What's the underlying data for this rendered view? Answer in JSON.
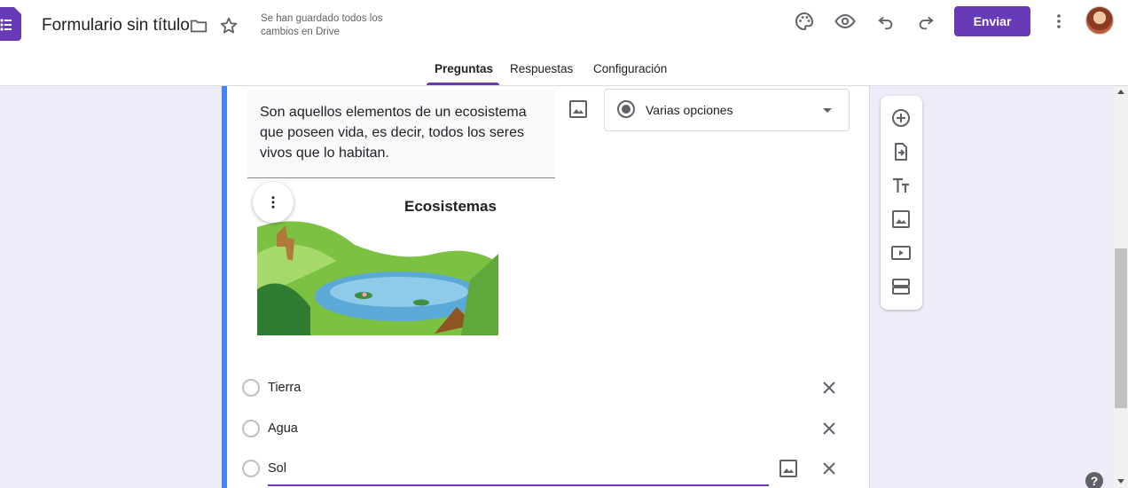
{
  "header": {
    "title": "Formulario sin título",
    "saved_status": "Se han guardado todos los cambios en Drive",
    "send_label": "Enviar",
    "icons": [
      "folder-icon",
      "star-icon",
      "palette-icon",
      "preview-icon",
      "undo-icon",
      "redo-icon",
      "more-vert-icon"
    ]
  },
  "tabs": [
    {
      "label": "Preguntas",
      "active": true
    },
    {
      "label": "Respuestas",
      "active": false
    },
    {
      "label": "Configuración",
      "active": false
    }
  ],
  "question": {
    "text": "Son aquellos elementos de un ecosistema que poseen vida, es decir, todos los seres vivos que lo habitan.",
    "type": "Varias opciones",
    "image_title": "Ecosistemas",
    "options": [
      "Tierra",
      "Agua",
      "Sol"
    ]
  },
  "side_toolbar": [
    "add-question-icon",
    "import-questions-icon",
    "add-title-icon",
    "add-image-icon",
    "add-video-icon",
    "add-section-icon"
  ],
  "colors": {
    "accent": "#673ab7",
    "card_border": "#4285f4",
    "background": "#f0ebf8"
  }
}
